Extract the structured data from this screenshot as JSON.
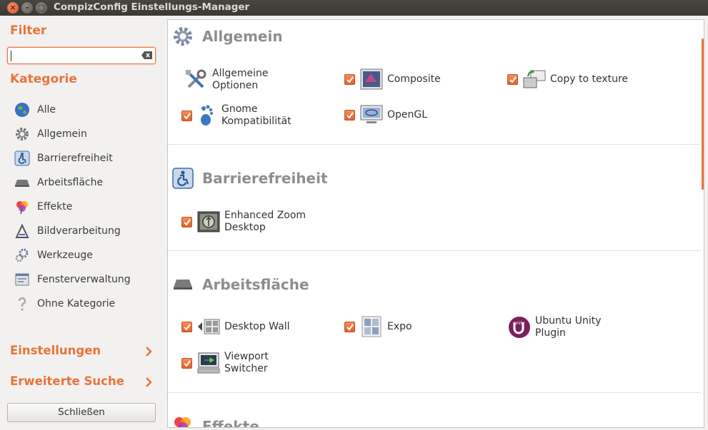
{
  "window": {
    "title": "CompizConfig Einstellungs-Manager"
  },
  "sidebar": {
    "filter_heading": "Filter",
    "filter_value": "",
    "category_heading": "Kategorie",
    "categories": [
      {
        "label": "Alle",
        "icon": "globe-icon"
      },
      {
        "label": "Allgemein",
        "icon": "gear-icon"
      },
      {
        "label": "Barrierefreiheit",
        "icon": "accessibility-icon"
      },
      {
        "label": "Arbeitsfläche",
        "icon": "desktop-icon"
      },
      {
        "label": "Effekte",
        "icon": "effects-icon"
      },
      {
        "label": "Bildverarbeitung",
        "icon": "image-processing-icon"
      },
      {
        "label": "Werkzeuge",
        "icon": "tools-icon"
      },
      {
        "label": "Fensterverwaltung",
        "icon": "window-management-icon"
      },
      {
        "label": "Ohne Kategorie",
        "icon": "question-icon"
      }
    ],
    "settings_label": "Einstellungen",
    "advanced_search_label": "Erweiterte Suche",
    "close_label": "Schließen"
  },
  "sections": [
    {
      "title": "Allgemein",
      "plugins": [
        {
          "label": "Allgemeine\nOptionen",
          "checkbox": false,
          "icon": "tools-icon"
        },
        {
          "label": "Composite",
          "checkbox": true,
          "icon": "composite-icon"
        },
        {
          "label": "Copy to texture",
          "checkbox": true,
          "icon": "copy-texture-icon"
        },
        {
          "label": "Gnome\nKompatibilität",
          "checkbox": true,
          "icon": "gnome-icon"
        },
        {
          "label": "OpenGL",
          "checkbox": true,
          "icon": "opengl-icon"
        }
      ]
    },
    {
      "title": "Barrierefreiheit",
      "plugins": [
        {
          "label": "Enhanced Zoom\nDesktop",
          "checkbox": true,
          "icon": "zoom-icon"
        }
      ]
    },
    {
      "title": "Arbeitsfläche",
      "plugins": [
        {
          "label": "Desktop Wall",
          "checkbox": true,
          "icon": "desktop-wall-icon"
        },
        {
          "label": "Expo",
          "checkbox": true,
          "icon": "expo-icon"
        },
        {
          "label": "Ubuntu Unity\nPlugin",
          "checkbox": false,
          "icon": "unity-icon",
          "icon_text": "unity"
        },
        {
          "label": "Viewport\nSwitcher",
          "checkbox": true,
          "icon": "viewport-icon"
        }
      ]
    },
    {
      "title": "Effekte",
      "plugins": []
    }
  ],
  "colors": {
    "accent": "#e8743b",
    "section_title": "#8e8e8e",
    "titlebar": "#3c3b37"
  }
}
